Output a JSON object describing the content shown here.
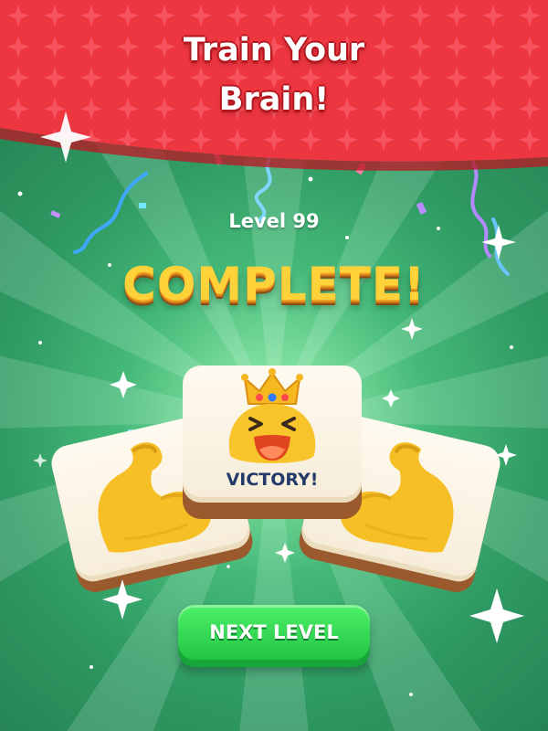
{
  "banner": {
    "title_line1": "Train Your",
    "title_line2": "Brain!",
    "color": "#f23a3f"
  },
  "result": {
    "level_label": "Level 99",
    "headline": "COMPLETE!"
  },
  "tiles": {
    "left_icon": "flexed-biceps-icon",
    "center_icon": "crowned-laughing-face-icon",
    "center_label": "VICTORY!",
    "right_icon": "flexed-biceps-icon"
  },
  "actions": {
    "next_level_label": "NEXT LEVEL",
    "button_color": "#2bd84c"
  },
  "colors": {
    "background": "#2e8f5e",
    "headline": "#ffd23a",
    "tile_face": "#fff8ea",
    "tile_base": "#9a5a2e",
    "victory_text": "#233a6a"
  }
}
